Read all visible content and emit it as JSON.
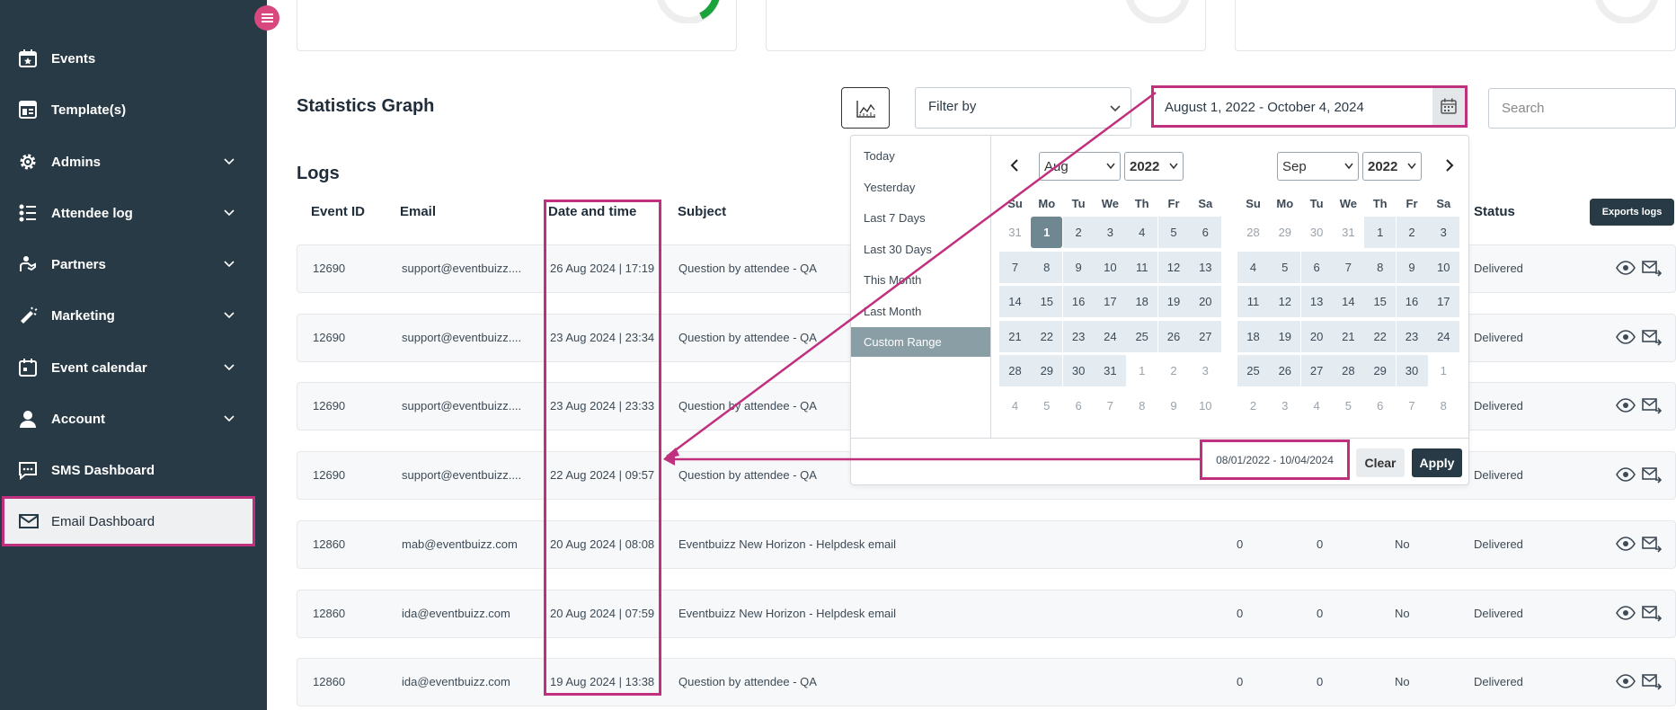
{
  "sidebar": {
    "items": [
      {
        "label": "Events"
      },
      {
        "label": "Template(s)"
      },
      {
        "label": "Admins"
      },
      {
        "label": "Attendee log"
      },
      {
        "label": "Partners"
      },
      {
        "label": "Marketing"
      },
      {
        "label": "Event calendar"
      },
      {
        "label": "Account"
      },
      {
        "label": "SMS Dashboard"
      },
      {
        "label": "Email Dashboard"
      }
    ]
  },
  "header": {
    "stats_title": "Statistics Graph",
    "filter_label": "Filter by",
    "date_range": "August 1, 2022 - October 4, 2024",
    "search_placeholder": "Search"
  },
  "logs": {
    "title": "Logs",
    "export_label": "Exports logs",
    "columns": [
      "Event ID",
      "Email",
      "Date and time",
      "Subject",
      "Status"
    ],
    "rows": [
      {
        "event_id": "12690",
        "email": "support@eventbuizz....",
        "datetime": "26 Aug 2024 | 17:19",
        "subject": "Question by attendee - QA",
        "c1": "",
        "c2": "",
        "c3": "",
        "status": "Delivered"
      },
      {
        "event_id": "12690",
        "email": "support@eventbuizz....",
        "datetime": "23 Aug 2024 | 23:34",
        "subject": "Question by attendee - QA",
        "c1": "",
        "c2": "",
        "c3": "",
        "status": "Delivered"
      },
      {
        "event_id": "12690",
        "email": "support@eventbuizz....",
        "datetime": "23 Aug 2024 | 23:33",
        "subject": "Question by attendee - QA",
        "c1": "",
        "c2": "",
        "c3": "",
        "status": "Delivered"
      },
      {
        "event_id": "12690",
        "email": "support@eventbuizz....",
        "datetime": "22 Aug 2024 | 09:57",
        "subject": "Question by attendee - QA",
        "c1": "",
        "c2": "",
        "c3": "",
        "status": "Delivered"
      },
      {
        "event_id": "12860",
        "email": "mab@eventbuizz.com",
        "datetime": "20 Aug 2024 | 08:08",
        "subject": "Eventbuizz New Horizon - Helpdesk email",
        "c1": "0",
        "c2": "0",
        "c3": "No",
        "status": "Delivered"
      },
      {
        "event_id": "12860",
        "email": "ida@eventbuizz.com",
        "datetime": "20 Aug 2024 | 07:59",
        "subject": "Eventbuizz New Horizon - Helpdesk email",
        "c1": "0",
        "c2": "0",
        "c3": "No",
        "status": "Delivered"
      },
      {
        "event_id": "12860",
        "email": "ida@eventbuizz.com",
        "datetime": "19 Aug 2024 | 13:38",
        "subject": "Question by attendee - QA",
        "c1": "0",
        "c2": "0",
        "c3": "No",
        "status": "Delivered"
      }
    ]
  },
  "picker": {
    "ranges": [
      "Today",
      "Yesterday",
      "Last 7 Days",
      "Last 30 Days",
      "This Month",
      "Last Month",
      "Custom Range"
    ],
    "active_range": "Custom Range",
    "weekdays": [
      "Su",
      "Mo",
      "Tu",
      "We",
      "Th",
      "Fr",
      "Sa"
    ],
    "left": {
      "month": "Aug",
      "year": "2022",
      "days": [
        [
          "31",
          "1",
          "2",
          "3",
          "4",
          "5",
          "6"
        ],
        [
          "7",
          "8",
          "9",
          "10",
          "11",
          "12",
          "13"
        ],
        [
          "14",
          "15",
          "16",
          "17",
          "18",
          "19",
          "20"
        ],
        [
          "21",
          "22",
          "23",
          "24",
          "25",
          "26",
          "27"
        ],
        [
          "28",
          "29",
          "30",
          "31",
          "1",
          "2",
          "3"
        ],
        [
          "4",
          "5",
          "6",
          "7",
          "8",
          "9",
          "10"
        ]
      ]
    },
    "right": {
      "month": "Sep",
      "year": "2022",
      "days": [
        [
          "28",
          "29",
          "30",
          "31",
          "1",
          "2",
          "3"
        ],
        [
          "4",
          "5",
          "6",
          "7",
          "8",
          "9",
          "10"
        ],
        [
          "11",
          "12",
          "13",
          "14",
          "15",
          "16",
          "17"
        ],
        [
          "18",
          "19",
          "20",
          "21",
          "22",
          "23",
          "24"
        ],
        [
          "25",
          "26",
          "27",
          "28",
          "29",
          "30",
          "1"
        ],
        [
          "2",
          "3",
          "4",
          "5",
          "6",
          "7",
          "8"
        ]
      ]
    },
    "range_text": "08/01/2022 - 10/04/2024",
    "clear_label": "Clear",
    "apply_label": "Apply"
  },
  "colors": {
    "sidebar_bg": "#283a45",
    "highlight": "#c1307f",
    "range_start": "#6f8790",
    "in_range": "#e4ecf1"
  }
}
